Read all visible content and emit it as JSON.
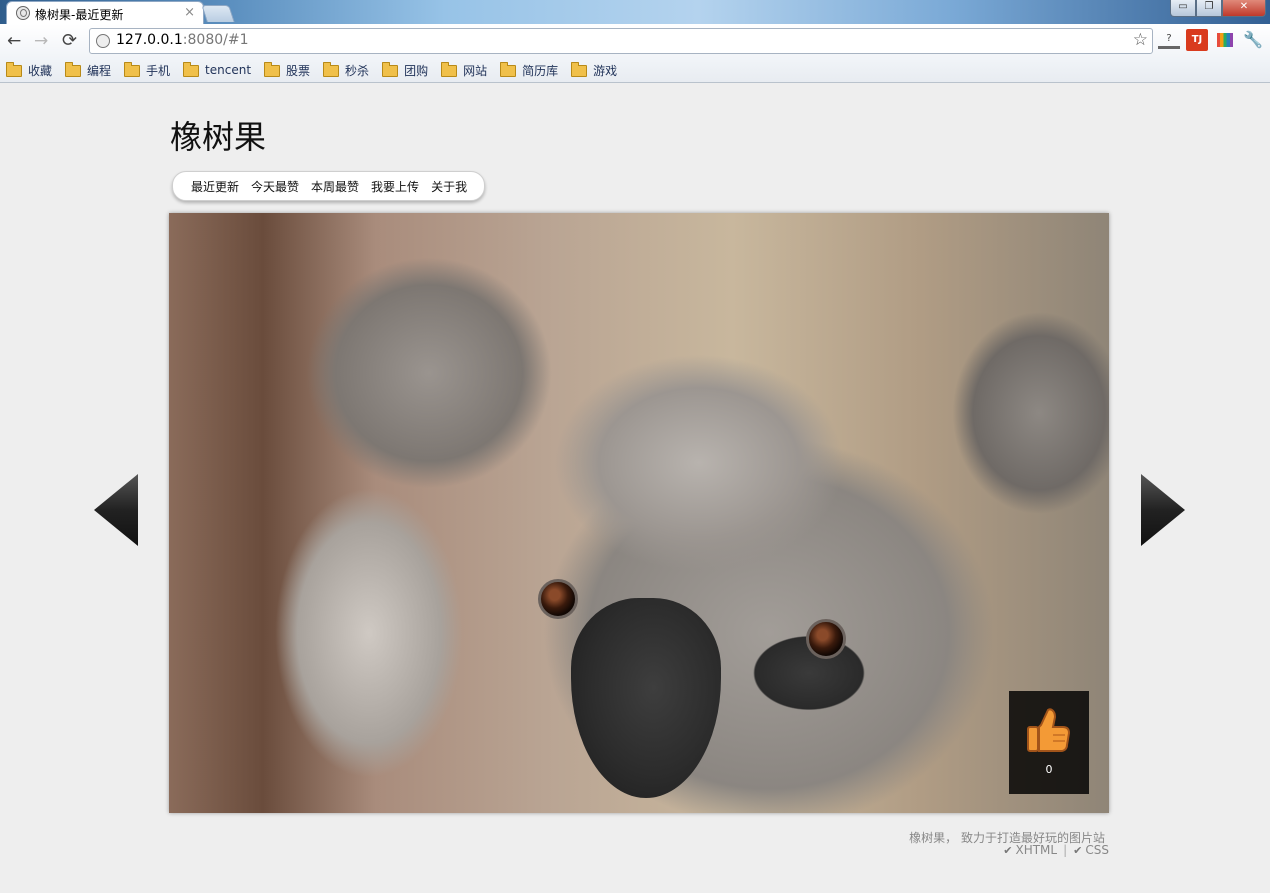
{
  "browser": {
    "tab_title": "橡树果-最近更新",
    "tab_close": "×",
    "url_host": "127.0.0.1",
    "url_path": ":8080/#1",
    "window_buttons": {
      "minimize": "▭",
      "maximize": "❐",
      "close": "✕"
    },
    "nav": {
      "back": "←",
      "forward": "→",
      "reload": "⟳",
      "star": "☆"
    },
    "tool_icons": [
      "help-icon",
      "translate-icon",
      "books-icon",
      "wrench-icon"
    ],
    "tool_icon_labels": {
      "help": "?",
      "translate": "TJ",
      "wrench": "🔧"
    },
    "bookmarks": [
      "收藏",
      "编程",
      "手机",
      "tencent",
      "股票",
      "秒杀",
      "团购",
      "网站",
      "简历库",
      "游戏"
    ]
  },
  "site": {
    "title": "橡树果",
    "menu": [
      "最近更新",
      "今天最赞",
      "本周最赞",
      "我要上传",
      "关于我"
    ]
  },
  "photo": {
    "subject": "koala",
    "like_icon": "thumbs-up-icon",
    "like_count": "0"
  },
  "footer": {
    "tagline": "橡树果， 致力于打造最好玩的图片站",
    "links": [
      "XHTML",
      "CSS"
    ],
    "separator": "|",
    "check": "✔"
  },
  "colors": {
    "page_bg": "#eeeeee",
    "like_box_bg": "#000000",
    "thumb": "#f0902a"
  }
}
